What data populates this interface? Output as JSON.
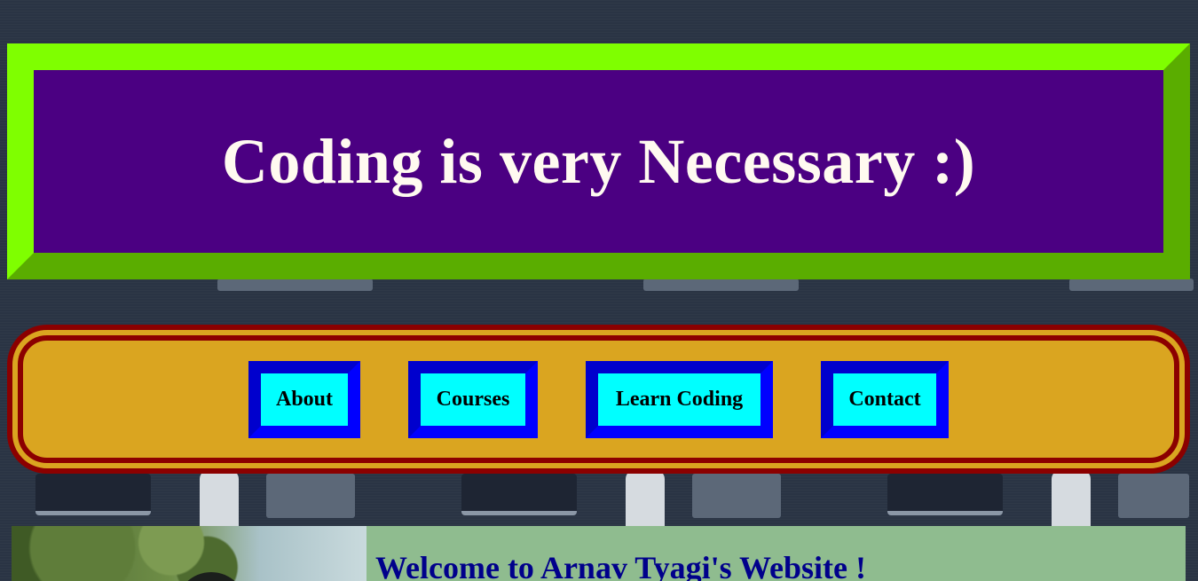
{
  "header": {
    "title": "Coding is very Necessary :)"
  },
  "nav": {
    "items": [
      {
        "label": "About"
      },
      {
        "label": "Courses"
      },
      {
        "label": "Learn Coding"
      },
      {
        "label": "Contact"
      }
    ]
  },
  "main": {
    "welcome_heading": "Welcome to Arnav Tyagi's Website !"
  },
  "colors": {
    "header_border": "#7fff00",
    "header_bg": "#4b0082",
    "nav_border": "#8b0000",
    "nav_bg": "#daa520",
    "button_bg": "#00ffff",
    "button_border": "#0000ff",
    "welcome_bg": "#8fbc8f",
    "welcome_text": "#00008b"
  }
}
